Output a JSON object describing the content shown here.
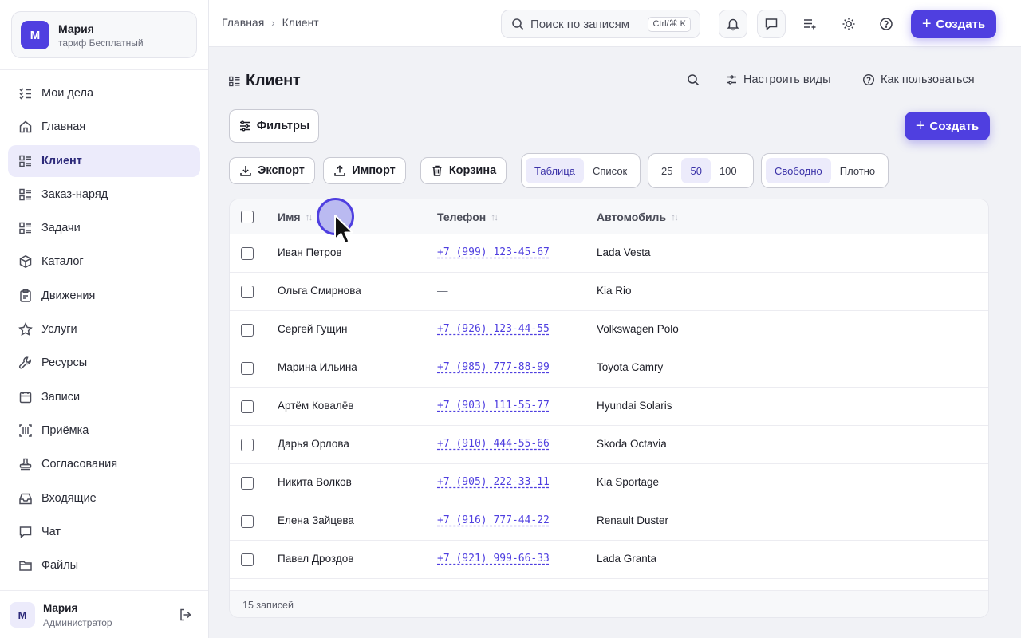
{
  "account": {
    "initial": "М",
    "name": "Мария",
    "plan": "тариф Бесплатный"
  },
  "sidebar": {
    "items": [
      {
        "label": "Мои дела",
        "icon": "checklist-icon"
      },
      {
        "label": "Главная",
        "icon": "home-icon"
      },
      {
        "label": "Клиент",
        "icon": "list-icon",
        "active": true
      },
      {
        "label": "Заказ-наряд",
        "icon": "list-icon"
      },
      {
        "label": "Задачи",
        "icon": "list-icon"
      },
      {
        "label": "Каталог",
        "icon": "box-icon"
      },
      {
        "label": "Движения",
        "icon": "clipboard-icon"
      },
      {
        "label": "Услуги",
        "icon": "star-icon"
      },
      {
        "label": "Ресурсы",
        "icon": "wrench-icon"
      },
      {
        "label": "Записи",
        "icon": "calendar-icon"
      },
      {
        "label": "Приёмка",
        "icon": "barcode-icon"
      },
      {
        "label": "Согласования",
        "icon": "stamp-icon"
      },
      {
        "label": "Входящие",
        "icon": "inbox-icon"
      },
      {
        "label": "Чат",
        "icon": "chat-icon"
      },
      {
        "label": "Файлы",
        "icon": "folder-icon"
      }
    ]
  },
  "user": {
    "initial": "М",
    "name": "Мария",
    "role": "Администратор"
  },
  "topbar": {
    "breadcrumbs": [
      "Главная",
      "Клиент"
    ],
    "search_placeholder": "Поиск по записям",
    "search_shortcut": "Ctrl/⌘ K",
    "create_label": "Создать"
  },
  "page": {
    "title": "Клиент",
    "tools": {
      "views": "Настроить виды",
      "help": "Как пользоваться"
    },
    "filters_label": "Фильтры",
    "create_label": "Создать",
    "actions": {
      "export": "Экспорт",
      "import": "Импорт",
      "trash": "Корзина"
    },
    "view_mode": {
      "options": [
        "Таблица",
        "Список"
      ],
      "selected": "Таблица"
    },
    "page_size": {
      "options": [
        "25",
        "50",
        "100"
      ],
      "selected": "50"
    },
    "density": {
      "options": [
        "Свободно",
        "Плотно"
      ],
      "selected": "Свободно"
    }
  },
  "table": {
    "columns": [
      "Имя",
      "Телефон",
      "Автомобиль"
    ],
    "rows": [
      {
        "name": "Иван Петров",
        "phone": "+7 (999) 123-45-67",
        "car": "Lada Vesta"
      },
      {
        "name": "Ольга Смирнова",
        "phone": "—",
        "car": "Kia Rio"
      },
      {
        "name": "Сергей Гущин",
        "phone": "+7 (926) 123-44-55",
        "car": "Volkswagen Polo"
      },
      {
        "name": "Марина Ильина",
        "phone": "+7 (985) 777-88-99",
        "car": "Toyota Camry"
      },
      {
        "name": "Артём Ковалёв",
        "phone": "+7 (903) 111-55-77",
        "car": "Hyundai Solaris"
      },
      {
        "name": "Дарья Орлова",
        "phone": "+7 (910) 444-55-66",
        "car": "Skoda Octavia"
      },
      {
        "name": "Никита Волков",
        "phone": "+7 (905) 222-33-11",
        "car": "Kia Sportage"
      },
      {
        "name": "Елена Зайцева",
        "phone": "+7 (916) 777-44-22",
        "car": "Renault Duster"
      },
      {
        "name": "Павел Дроздов",
        "phone": "+7 (921) 999-66-33",
        "car": "Lada Granta"
      }
    ],
    "count_label": "15 записей"
  },
  "colors": {
    "accent": "#4f3fe0",
    "active_bg": "#ecebfb"
  }
}
